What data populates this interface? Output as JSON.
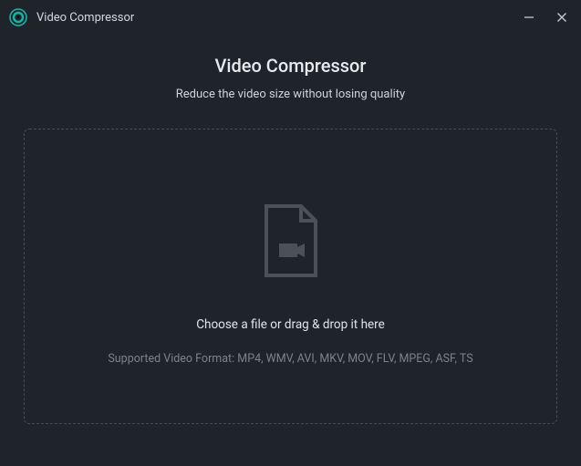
{
  "titlebar": {
    "title": "Video Compressor"
  },
  "main": {
    "title": "Video Compressor",
    "subtitle": "Reduce the video size without losing quality"
  },
  "dropzone": {
    "instruction": "Choose a file or drag & drop it here",
    "formats_label": "Supported Video Format: MP4, WMV, AVI, MKV, MOV, FLV, MPEG, ASF, TS"
  }
}
